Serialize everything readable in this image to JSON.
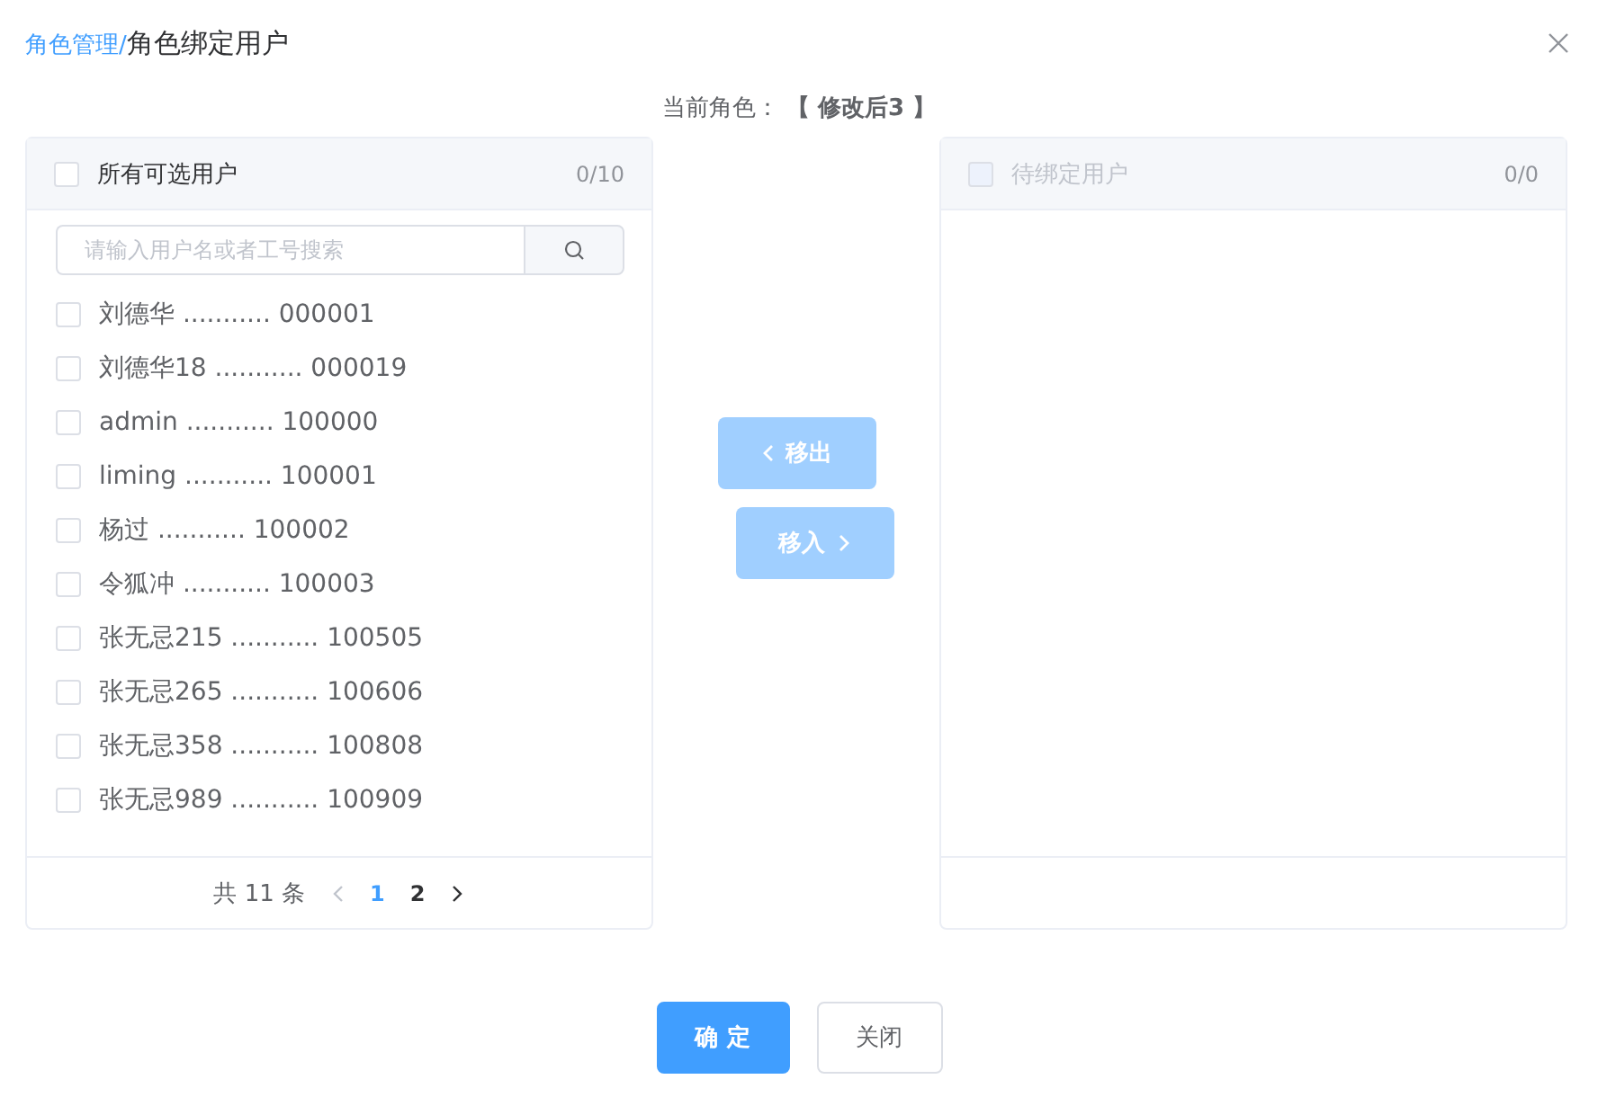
{
  "dialog": {
    "breadcrumb": "角色管理/",
    "title": "角色绑定用户"
  },
  "current_role": {
    "label": "当前角色：",
    "value": "【 修改后3 】"
  },
  "source_panel": {
    "title": "所有可选用户",
    "checked": false,
    "disabled": false,
    "count": "0/10",
    "search": {
      "placeholder": "请输入用户名或者工号搜索"
    },
    "items": [
      {
        "label": "刘德华 ........... 000001",
        "checked": false
      },
      {
        "label": "刘德华18 ........... 000019",
        "checked": false
      },
      {
        "label": "admin ........... 100000",
        "checked": false
      },
      {
        "label": "liming ........... 100001",
        "checked": false
      },
      {
        "label": "杨过 ........... 100002",
        "checked": false
      },
      {
        "label": "令狐冲 ........... 100003",
        "checked": false
      },
      {
        "label": "张无忌215 ........... 100505",
        "checked": false
      },
      {
        "label": "张无忌265 ........... 100606",
        "checked": false
      },
      {
        "label": "张无忌358 ........... 100808",
        "checked": false
      },
      {
        "label": "张无忌989 ........... 100909",
        "checked": false
      }
    ],
    "pagination": {
      "total": "共 11 条",
      "prev_disabled": true,
      "pages": [
        {
          "label": "1",
          "selected": true
        },
        {
          "label": "2",
          "selected": false
        }
      ]
    }
  },
  "transfer_buttons": [
    {
      "kind": "left",
      "label": "移出",
      "disabled": true
    },
    {
      "kind": "right",
      "label": "移入",
      "disabled": true
    }
  ],
  "target_panel": {
    "title": "待绑定用户",
    "checked": false,
    "disabled": true,
    "count": "0/0"
  },
  "footer_buttons": [
    {
      "kind": "primary",
      "label": "确 定"
    },
    {
      "kind": "default",
      "label": "关闭"
    }
  ]
}
